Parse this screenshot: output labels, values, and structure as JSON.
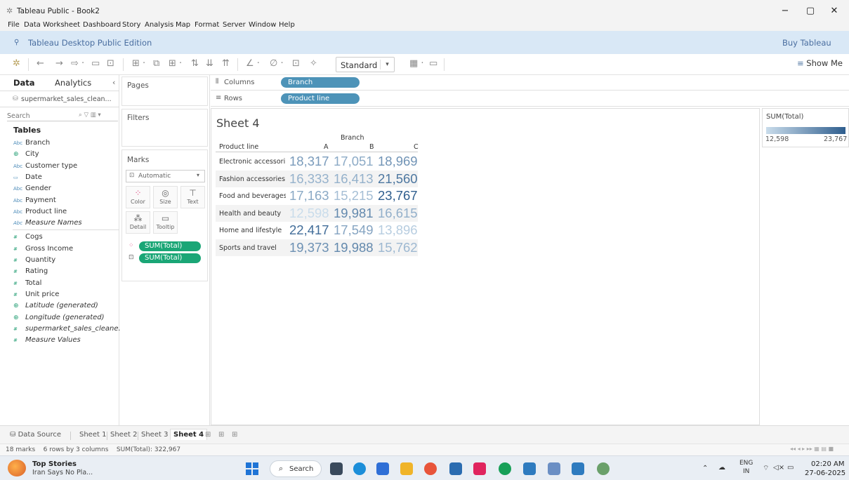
{
  "window": {
    "title": "Tableau Public - Book2",
    "minimize": "−",
    "maximize": "▢",
    "close": "✕"
  },
  "menu": [
    "File",
    "Data",
    "Worksheet",
    "Dashboard",
    "Story",
    "Analysis",
    "Map",
    "Format",
    "Server",
    "Window",
    "Help"
  ],
  "banner": {
    "edition": "Tableau Desktop Public Edition",
    "buy": "Buy Tableau"
  },
  "toolbar": {
    "fit": "Standard",
    "show_me": "Show Me"
  },
  "data_pane": {
    "tab_data": "Data",
    "tab_analytics": "Analytics",
    "datasource": "supermarket_sales_clean...",
    "search_placeholder": "Search",
    "tables_heading": "Tables",
    "fields": [
      {
        "label": "Branch",
        "kind": "dim",
        "icon": "Abc"
      },
      {
        "label": "City",
        "kind": "geo",
        "icon": "⊕"
      },
      {
        "label": "Customer type",
        "kind": "dim",
        "icon": "Abc"
      },
      {
        "label": "Date",
        "kind": "dim",
        "icon": "▭"
      },
      {
        "label": "Gender",
        "kind": "dim",
        "icon": "Abc"
      },
      {
        "label": "Payment",
        "kind": "dim",
        "icon": "Abc"
      },
      {
        "label": "Product line",
        "kind": "dim",
        "icon": "Abc"
      },
      {
        "label": "Measure Names",
        "kind": "dim",
        "icon": "Abc",
        "italic": true
      },
      {
        "label": "Cogs",
        "kind": "meas",
        "icon": "#"
      },
      {
        "label": "Gross Income",
        "kind": "meas",
        "icon": "#"
      },
      {
        "label": "Quantity",
        "kind": "meas",
        "icon": "#"
      },
      {
        "label": "Rating",
        "kind": "meas",
        "icon": "#"
      },
      {
        "label": "Total",
        "kind": "meas",
        "icon": "#"
      },
      {
        "label": "Unit price",
        "kind": "meas",
        "icon": "#"
      },
      {
        "label": "Latitude (generated)",
        "kind": "geo",
        "icon": "⊕",
        "italic": true
      },
      {
        "label": "Longitude (generated)",
        "kind": "geo",
        "icon": "⊕",
        "italic": true
      },
      {
        "label": "supermarket_sales_cleane...",
        "kind": "meas",
        "icon": "#",
        "italic": true
      },
      {
        "label": "Measure Values",
        "kind": "meas",
        "icon": "#",
        "italic": true
      }
    ]
  },
  "cards": {
    "pages": "Pages",
    "filters": "Filters",
    "marks": "Marks",
    "mark_type": "Automatic",
    "buttons": {
      "color": "Color",
      "size": "Size",
      "text": "Text",
      "detail": "Detail",
      "tooltip": "Tooltip"
    },
    "pills": [
      "SUM(Total)",
      "SUM(Total)"
    ]
  },
  "shelves": {
    "columns_label": "Columns",
    "columns_pill": "Branch",
    "rows_label": "Rows",
    "rows_pill": "Product line"
  },
  "view": {
    "sheet_title": "Sheet 4",
    "column_group_header": "Branch",
    "row_header": "Product line",
    "columns": [
      "A",
      "B",
      "C"
    ],
    "rows": [
      {
        "label": "Electronic accessori..",
        "values": [
          "18,317",
          "17,051",
          "18,969"
        ]
      },
      {
        "label": "Fashion accessories",
        "values": [
          "16,333",
          "16,413",
          "21,560"
        ]
      },
      {
        "label": "Food and beverages",
        "values": [
          "17,163",
          "15,215",
          "23,767"
        ]
      },
      {
        "label": "Health and beauty",
        "values": [
          "12,598",
          "19,981",
          "16,615"
        ]
      },
      {
        "label": "Home and lifestyle",
        "values": [
          "22,417",
          "17,549",
          "13,896"
        ]
      },
      {
        "label": "Sports and travel",
        "values": [
          "19,373",
          "19,988",
          "15,762"
        ]
      }
    ],
    "color_min": "#c9dceb",
    "color_max": "#2f5e8e"
  },
  "legend": {
    "title": "SUM(Total)",
    "min": "12,598",
    "max": "23,767"
  },
  "sheet_tabs": {
    "data_source": "Data Source",
    "sheets": [
      "Sheet 1",
      "Sheet 2",
      "Sheet 3",
      "Sheet 4"
    ],
    "active": "Sheet 4"
  },
  "status": {
    "text": "18 marks    6 rows by 3 columns    SUM(Total): 322,967"
  },
  "taskbar": {
    "news_title": "Top Stories",
    "news_sub": "Iran Says No Pla...",
    "search": "Search",
    "lang": "ENG",
    "lang_region": "IN",
    "time": "02:20 AM",
    "date": "27-06-2025"
  }
}
